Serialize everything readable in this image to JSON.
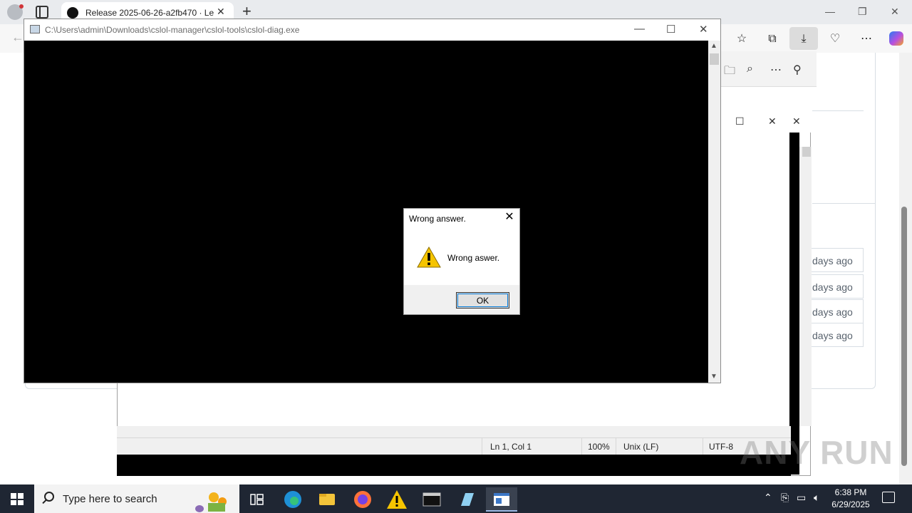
{
  "browser": {
    "tab_title": "Release 2025-06-26-a2fb470 · Le",
    "tab_close": "✕",
    "new_tab": "+",
    "window_min": "—",
    "window_restore": "❐",
    "window_close": "✕"
  },
  "page": {
    "asset_times": [
      "days ago",
      "days ago",
      "days ago",
      "days ago"
    ]
  },
  "notepad": {
    "status": {
      "position": "Ln 1, Col 1",
      "zoom": "100%",
      "line_ending": "Unix (LF)",
      "encoding": "UTF-8"
    }
  },
  "console": {
    "title": "C:\\Users\\admin\\Downloads\\cslol-manager\\cslol-tools\\cslol-diag.exe"
  },
  "dialog": {
    "title": "Wrong answer.",
    "message": "Wrong aswer.",
    "ok_label": "OK",
    "icon": "warning-icon"
  },
  "taskbar": {
    "search_placeholder": "Type here to search",
    "time": "6:38 PM",
    "date": "6/29/2025"
  },
  "watermark": "ANY RUN",
  "colors": {
    "taskbar": "#1f2633",
    "console_bg": "#000000",
    "accent": "#0078d7",
    "warning": "#f5c400"
  }
}
